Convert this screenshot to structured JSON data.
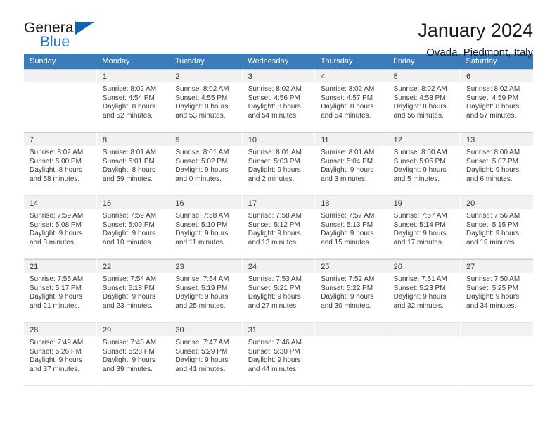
{
  "brand": {
    "word_one": "General",
    "word_two": "Blue",
    "flag_icon": "blue-triangle-flag-icon"
  },
  "header": {
    "title": "January 2024",
    "subtitle": "Ovada, Piedmont, Italy"
  },
  "colors": {
    "header_row_bg": "#3b7cb9",
    "daynum_band_bg": "#f1f1f1",
    "brand_blue": "#1f7ac4",
    "flag_blue": "#1263ad",
    "grid_line": "#e3e3e3"
  },
  "calendar": {
    "weekday_headers": [
      "Sunday",
      "Monday",
      "Tuesday",
      "Wednesday",
      "Thursday",
      "Friday",
      "Saturday"
    ],
    "weeks": [
      [
        {
          "day": "",
          "lines": []
        },
        {
          "day": "1",
          "lines": [
            "Sunrise: 8:02 AM",
            "Sunset: 4:54 PM",
            "Daylight: 8 hours",
            "and 52 minutes."
          ]
        },
        {
          "day": "2",
          "lines": [
            "Sunrise: 8:02 AM",
            "Sunset: 4:55 PM",
            "Daylight: 8 hours",
            "and 53 minutes."
          ]
        },
        {
          "day": "3",
          "lines": [
            "Sunrise: 8:02 AM",
            "Sunset: 4:56 PM",
            "Daylight: 8 hours",
            "and 54 minutes."
          ]
        },
        {
          "day": "4",
          "lines": [
            "Sunrise: 8:02 AM",
            "Sunset: 4:57 PM",
            "Daylight: 8 hours",
            "and 54 minutes."
          ]
        },
        {
          "day": "5",
          "lines": [
            "Sunrise: 8:02 AM",
            "Sunset: 4:58 PM",
            "Daylight: 8 hours",
            "and 56 minutes."
          ]
        },
        {
          "day": "6",
          "lines": [
            "Sunrise: 8:02 AM",
            "Sunset: 4:59 PM",
            "Daylight: 8 hours",
            "and 57 minutes."
          ]
        }
      ],
      [
        {
          "day": "7",
          "lines": [
            "Sunrise: 8:02 AM",
            "Sunset: 5:00 PM",
            "Daylight: 8 hours",
            "and 58 minutes."
          ]
        },
        {
          "day": "8",
          "lines": [
            "Sunrise: 8:01 AM",
            "Sunset: 5:01 PM",
            "Daylight: 8 hours",
            "and 59 minutes."
          ]
        },
        {
          "day": "9",
          "lines": [
            "Sunrise: 8:01 AM",
            "Sunset: 5:02 PM",
            "Daylight: 9 hours",
            "and 0 minutes."
          ]
        },
        {
          "day": "10",
          "lines": [
            "Sunrise: 8:01 AM",
            "Sunset: 5:03 PM",
            "Daylight: 9 hours",
            "and 2 minutes."
          ]
        },
        {
          "day": "11",
          "lines": [
            "Sunrise: 8:01 AM",
            "Sunset: 5:04 PM",
            "Daylight: 9 hours",
            "and 3 minutes."
          ]
        },
        {
          "day": "12",
          "lines": [
            "Sunrise: 8:00 AM",
            "Sunset: 5:05 PM",
            "Daylight: 9 hours",
            "and 5 minutes."
          ]
        },
        {
          "day": "13",
          "lines": [
            "Sunrise: 8:00 AM",
            "Sunset: 5:07 PM",
            "Daylight: 9 hours",
            "and 6 minutes."
          ]
        }
      ],
      [
        {
          "day": "14",
          "lines": [
            "Sunrise: 7:59 AM",
            "Sunset: 5:08 PM",
            "Daylight: 9 hours",
            "and 8 minutes."
          ]
        },
        {
          "day": "15",
          "lines": [
            "Sunrise: 7:59 AM",
            "Sunset: 5:09 PM",
            "Daylight: 9 hours",
            "and 10 minutes."
          ]
        },
        {
          "day": "16",
          "lines": [
            "Sunrise: 7:58 AM",
            "Sunset: 5:10 PM",
            "Daylight: 9 hours",
            "and 11 minutes."
          ]
        },
        {
          "day": "17",
          "lines": [
            "Sunrise: 7:58 AM",
            "Sunset: 5:12 PM",
            "Daylight: 9 hours",
            "and 13 minutes."
          ]
        },
        {
          "day": "18",
          "lines": [
            "Sunrise: 7:57 AM",
            "Sunset: 5:13 PM",
            "Daylight: 9 hours",
            "and 15 minutes."
          ]
        },
        {
          "day": "19",
          "lines": [
            "Sunrise: 7:57 AM",
            "Sunset: 5:14 PM",
            "Daylight: 9 hours",
            "and 17 minutes."
          ]
        },
        {
          "day": "20",
          "lines": [
            "Sunrise: 7:56 AM",
            "Sunset: 5:15 PM",
            "Daylight: 9 hours",
            "and 19 minutes."
          ]
        }
      ],
      [
        {
          "day": "21",
          "lines": [
            "Sunrise: 7:55 AM",
            "Sunset: 5:17 PM",
            "Daylight: 9 hours",
            "and 21 minutes."
          ]
        },
        {
          "day": "22",
          "lines": [
            "Sunrise: 7:54 AM",
            "Sunset: 5:18 PM",
            "Daylight: 9 hours",
            "and 23 minutes."
          ]
        },
        {
          "day": "23",
          "lines": [
            "Sunrise: 7:54 AM",
            "Sunset: 5:19 PM",
            "Daylight: 9 hours",
            "and 25 minutes."
          ]
        },
        {
          "day": "24",
          "lines": [
            "Sunrise: 7:53 AM",
            "Sunset: 5:21 PM",
            "Daylight: 9 hours",
            "and 27 minutes."
          ]
        },
        {
          "day": "25",
          "lines": [
            "Sunrise: 7:52 AM",
            "Sunset: 5:22 PM",
            "Daylight: 9 hours",
            "and 30 minutes."
          ]
        },
        {
          "day": "26",
          "lines": [
            "Sunrise: 7:51 AM",
            "Sunset: 5:23 PM",
            "Daylight: 9 hours",
            "and 32 minutes."
          ]
        },
        {
          "day": "27",
          "lines": [
            "Sunrise: 7:50 AM",
            "Sunset: 5:25 PM",
            "Daylight: 9 hours",
            "and 34 minutes."
          ]
        }
      ],
      [
        {
          "day": "28",
          "lines": [
            "Sunrise: 7:49 AM",
            "Sunset: 5:26 PM",
            "Daylight: 9 hours",
            "and 37 minutes."
          ]
        },
        {
          "day": "29",
          "lines": [
            "Sunrise: 7:48 AM",
            "Sunset: 5:28 PM",
            "Daylight: 9 hours",
            "and 39 minutes."
          ]
        },
        {
          "day": "30",
          "lines": [
            "Sunrise: 7:47 AM",
            "Sunset: 5:29 PM",
            "Daylight: 9 hours",
            "and 41 minutes."
          ]
        },
        {
          "day": "31",
          "lines": [
            "Sunrise: 7:46 AM",
            "Sunset: 5:30 PM",
            "Daylight: 9 hours",
            "and 44 minutes."
          ]
        },
        {
          "day": "",
          "lines": []
        },
        {
          "day": "",
          "lines": []
        },
        {
          "day": "",
          "lines": []
        }
      ]
    ]
  }
}
